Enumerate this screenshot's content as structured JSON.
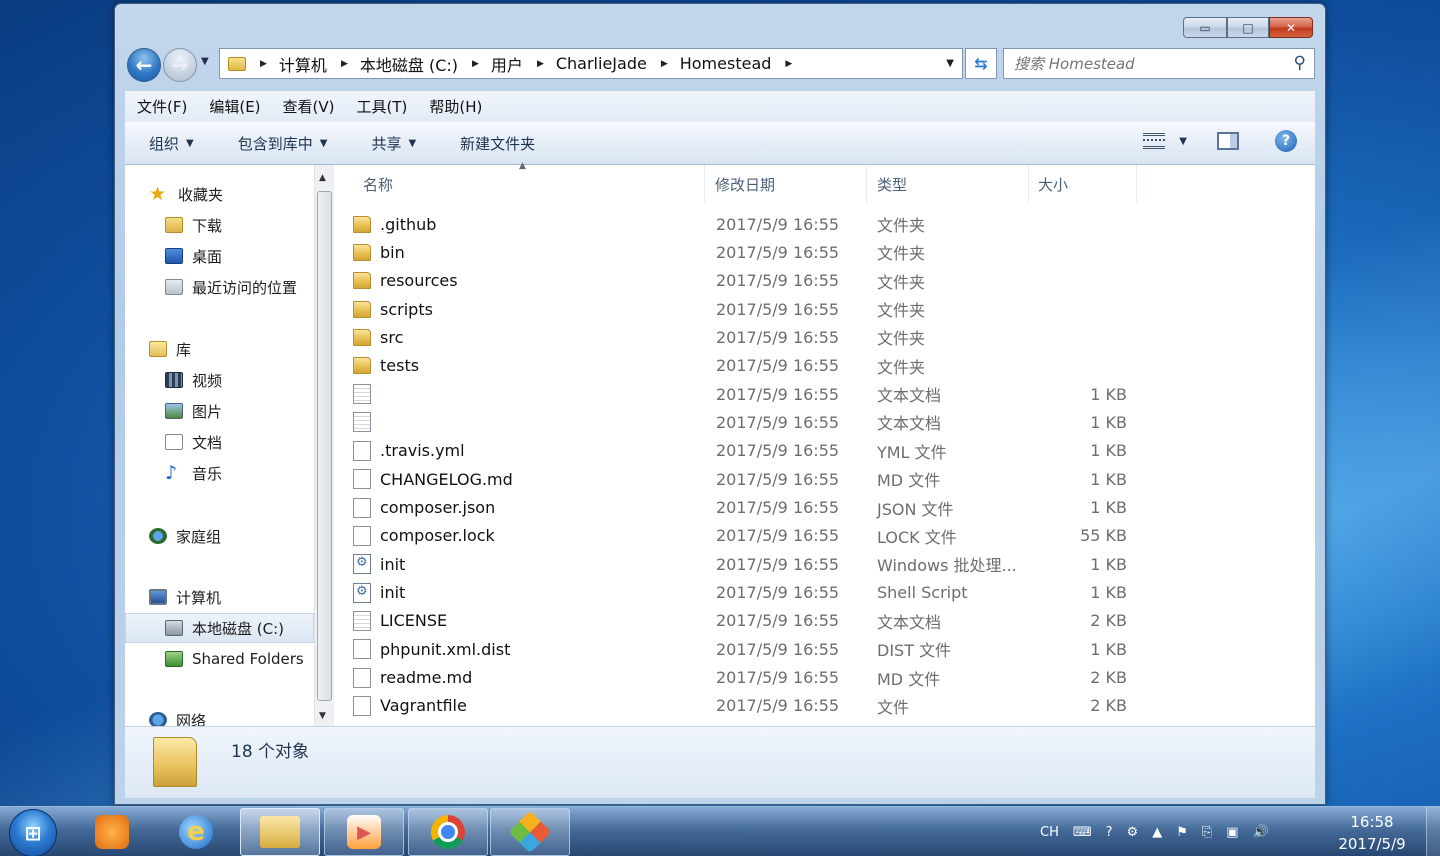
{
  "window": {
    "controls": {
      "minimize": "▭",
      "maximize": "□",
      "close": "✕"
    }
  },
  "address": {
    "crumbs": [
      "计算机",
      "本地磁盘 (C:)",
      "用户",
      "CharlieJade",
      "Homestead"
    ]
  },
  "search": {
    "placeholder": "搜索 Homestead"
  },
  "menu": [
    "文件(F)",
    "编辑(E)",
    "查看(V)",
    "工具(T)",
    "帮助(H)"
  ],
  "toolbar": {
    "organize": "组织",
    "include_in_library": "包含到库中",
    "share": "共享",
    "new_folder": "新建文件夹"
  },
  "nav": {
    "favorites": "收藏夹",
    "downloads": "下载",
    "desktop": "桌面",
    "recent": "最近访问的位置",
    "libraries": "库",
    "videos": "视频",
    "pictures": "图片",
    "documents": "文档",
    "music": "音乐",
    "homegroup": "家庭组",
    "computer": "计算机",
    "local_disk": "本地磁盘 (C:)",
    "shared_folders": "Shared Folders",
    "network": "网络"
  },
  "columns": {
    "name": "名称",
    "date": "修改日期",
    "type": "类型",
    "size": "大小"
  },
  "files": [
    {
      "name": ".github",
      "date": "2017/5/9 16:55",
      "type": "文件夹",
      "size": "",
      "icon": "folder"
    },
    {
      "name": "bin",
      "date": "2017/5/9 16:55",
      "type": "文件夹",
      "size": "",
      "icon": "folder"
    },
    {
      "name": "resources",
      "date": "2017/5/9 16:55",
      "type": "文件夹",
      "size": "",
      "icon": "folder"
    },
    {
      "name": "scripts",
      "date": "2017/5/9 16:55",
      "type": "文件夹",
      "size": "",
      "icon": "folder"
    },
    {
      "name": "src",
      "date": "2017/5/9 16:55",
      "type": "文件夹",
      "size": "",
      "icon": "folder"
    },
    {
      "name": "tests",
      "date": "2017/5/9 16:55",
      "type": "文件夹",
      "size": "",
      "icon": "folder"
    },
    {
      "name": "",
      "date": "2017/5/9 16:55",
      "type": "文本文档",
      "size": "1 KB",
      "icon": "text"
    },
    {
      "name": "",
      "date": "2017/5/9 16:55",
      "type": "文本文档",
      "size": "1 KB",
      "icon": "text"
    },
    {
      "name": ".travis.yml",
      "date": "2017/5/9 16:55",
      "type": "YML 文件",
      "size": "1 KB",
      "icon": "blank"
    },
    {
      "name": "CHANGELOG.md",
      "date": "2017/5/9 16:55",
      "type": "MD 文件",
      "size": "1 KB",
      "icon": "blank"
    },
    {
      "name": "composer.json",
      "date": "2017/5/9 16:55",
      "type": "JSON 文件",
      "size": "1 KB",
      "icon": "blank"
    },
    {
      "name": "composer.lock",
      "date": "2017/5/9 16:55",
      "type": "LOCK 文件",
      "size": "55 KB",
      "icon": "blank"
    },
    {
      "name": "init",
      "date": "2017/5/9 16:55",
      "type": "Windows 批处理...",
      "size": "1 KB",
      "icon": "script"
    },
    {
      "name": "init",
      "date": "2017/5/9 16:55",
      "type": "Shell Script",
      "size": "1 KB",
      "icon": "script"
    },
    {
      "name": "LICENSE",
      "date": "2017/5/9 16:55",
      "type": "文本文档",
      "size": "2 KB",
      "icon": "text"
    },
    {
      "name": "phpunit.xml.dist",
      "date": "2017/5/9 16:55",
      "type": "DIST 文件",
      "size": "1 KB",
      "icon": "blank"
    },
    {
      "name": "readme.md",
      "date": "2017/5/9 16:55",
      "type": "MD 文件",
      "size": "2 KB",
      "icon": "blank"
    },
    {
      "name": "Vagrantfile",
      "date": "2017/5/9 16:55",
      "type": "文件",
      "size": "2 KB",
      "icon": "blank"
    }
  ],
  "status": {
    "count": "18 个对象"
  },
  "taskbar": {
    "tray": {
      "lang": "CH"
    },
    "clock": {
      "time": "16:58",
      "date": "2017/5/9"
    }
  }
}
